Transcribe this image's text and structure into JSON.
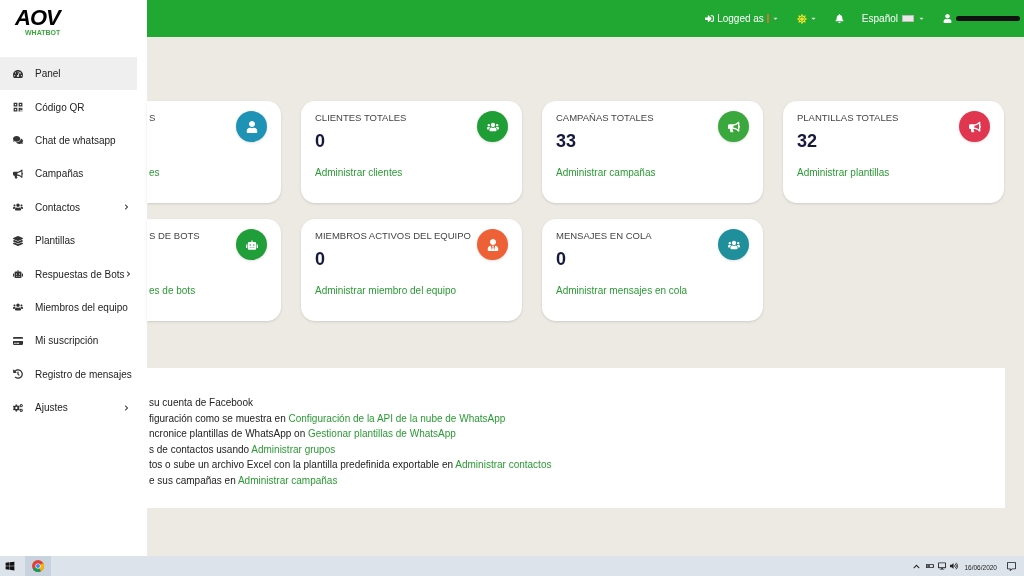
{
  "logo": {
    "mark": "AOV",
    "sub": "WHATBOT"
  },
  "header": {
    "logged_label": "Logged as",
    "language": "Español"
  },
  "sidebar": {
    "items": [
      {
        "label": "Panel",
        "selected": true,
        "expandable": false
      },
      {
        "label": "Código QR",
        "selected": false,
        "expandable": false
      },
      {
        "label": "Chat de whatsapp",
        "selected": false,
        "expandable": false
      },
      {
        "label": "Campañas",
        "selected": false,
        "expandable": false
      },
      {
        "label": "Contactos",
        "selected": false,
        "expandable": true
      },
      {
        "label": "Plantillas",
        "selected": false,
        "expandable": false
      },
      {
        "label": "Respuestas de Bots",
        "selected": false,
        "expandable": true
      },
      {
        "label": "Miembros del equipo",
        "selected": false,
        "expandable": false
      },
      {
        "label": "Mi suscripción",
        "selected": false,
        "expandable": false
      },
      {
        "label": "Registro de mensajes",
        "selected": false,
        "expandable": false
      },
      {
        "label": "Ajustes",
        "selected": false,
        "expandable": true
      }
    ]
  },
  "cards": [
    {
      "title": "S",
      "link": "es",
      "color": "#1f93b6"
    },
    {
      "title": "CLIENTES TOTALES",
      "value": "0",
      "link": "Administrar clientes",
      "color": "#1f9e35"
    },
    {
      "title": "CAMPAÑAS TOTALES",
      "value": "33",
      "link": "Administrar campañas",
      "color": "#3aa83d"
    },
    {
      "title": "PLANTILLAS TOTALES",
      "value": "32",
      "link": "Administrar plantillas",
      "color": "#e0364f"
    },
    {
      "title": "S DE BOTS",
      "link": "es de bots",
      "color": "#1f9e3a"
    },
    {
      "title": "MIEMBROS ACTIVOS DEL EQUIPO",
      "value": "0",
      "link": "Administrar miembro del equipo",
      "color": "#ee6136"
    },
    {
      "title": "MENSAJES EN COLA",
      "value": "0",
      "link": "Administrar mensajes en cola",
      "color": "#1f8f9b"
    }
  ],
  "instructions": [
    {
      "text": "su cuenta de Facebook"
    },
    {
      "text": "figuración como se muestra en ",
      "link": "Configuración de la API de la nube de WhatsApp"
    },
    {
      "text": "ncronice plantillas de WhatsApp on ",
      "link": "Gestionar plantillas de WhatsApp"
    },
    {
      "text": "s de contactos usando ",
      "link": "Administrar grupos"
    },
    {
      "text": "tos o sube un archivo Excel con la plantilla predefinida exportable en ",
      "link": "Administrar contactos"
    },
    {
      "text": "e sus campañas en ",
      "link": "Administrar campañas"
    }
  ],
  "taskbar": {
    "date": "16/06/2020"
  }
}
